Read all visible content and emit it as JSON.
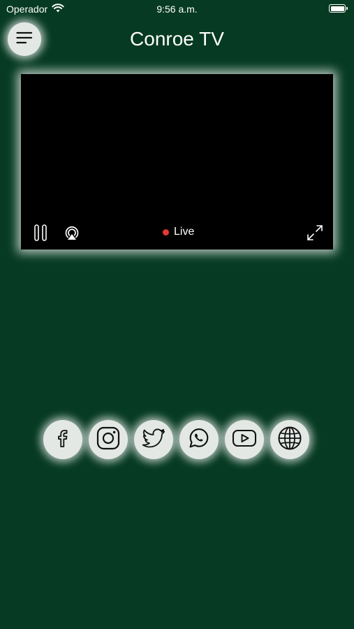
{
  "status_bar": {
    "carrier": "Operador",
    "time": "9:56 a.m."
  },
  "header": {
    "title": "Conroe TV",
    "menu_icon": "hamburger-menu-icon"
  },
  "player": {
    "live_label": "Live",
    "controls": [
      "pause-icon",
      "airplay-icon",
      "fullscreen-icon"
    ]
  },
  "social": {
    "icons": [
      "facebook-icon",
      "instagram-icon",
      "twitter-icon",
      "whatsapp-icon",
      "youtube-icon",
      "globe-icon"
    ]
  },
  "colors": {
    "background": "#063a22",
    "button_bg": "#e3e8e5",
    "live_dot": "#e53935",
    "player_bg": "#000000"
  }
}
